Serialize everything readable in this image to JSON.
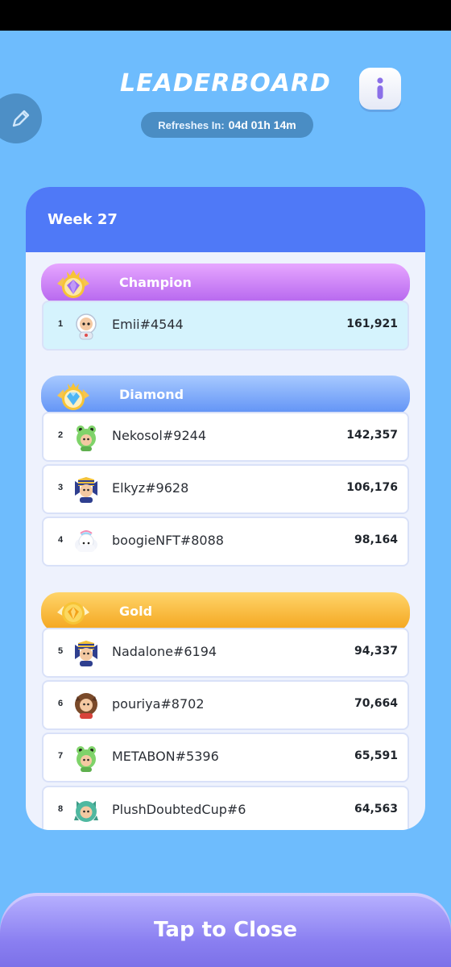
{
  "header": {
    "title": "LEADERBOARD",
    "refresh_label": "Refreshes In:",
    "refresh_value": "04d 01h 14m"
  },
  "icons": {
    "edit": "pencil-icon",
    "info": "info-icon"
  },
  "board": {
    "week": "Week 27",
    "tiers": [
      {
        "label": "Champion",
        "color": "#c27af3"
      },
      {
        "label": "Diamond",
        "color": "#6f9cf7"
      },
      {
        "label": "Gold",
        "color": "#f5b12c"
      }
    ],
    "rows": [
      {
        "rank": "1",
        "name": "Emii#4544",
        "score": "161,921",
        "avatar": "astronaut"
      },
      {
        "rank": "2",
        "name": "Nekosol#9244",
        "score": "142,357",
        "avatar": "frog"
      },
      {
        "rank": "3",
        "name": "Elkyz#9628",
        "score": "106,176",
        "avatar": "pharaoh"
      },
      {
        "rank": "4",
        "name": "boogieNFT#8088",
        "score": "98,164",
        "avatar": "cloud"
      },
      {
        "rank": "5",
        "name": "Nadalone#6194",
        "score": "94,337",
        "avatar": "pharaoh"
      },
      {
        "rank": "6",
        "name": "pouriya#8702",
        "score": "70,664",
        "avatar": "lion"
      },
      {
        "rank": "7",
        "name": "METABON#5396",
        "score": "65,591",
        "avatar": "frog"
      },
      {
        "rank": "8",
        "name": "PlushDoubtedCup#6",
        "score": "64,563",
        "avatar": "dragon"
      }
    ]
  },
  "footer": {
    "close_label": "Tap to Close"
  },
  "colors": {
    "background": "#6ebcfd",
    "header_blue": "#4f79f7",
    "close_button": "#8a7ff1"
  }
}
